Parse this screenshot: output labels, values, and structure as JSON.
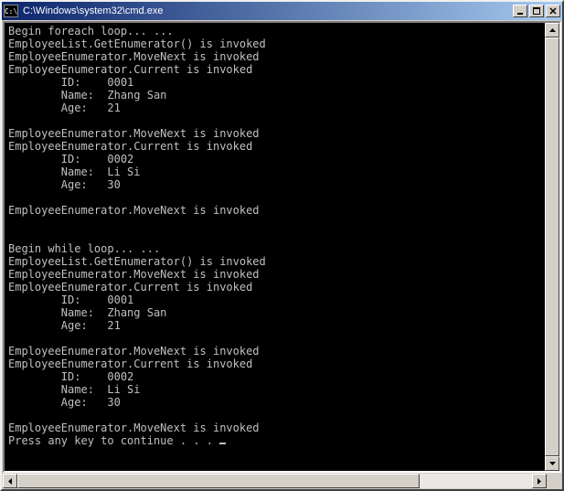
{
  "window": {
    "title": "C:\\Windows\\system32\\cmd.exe",
    "icon_label": "C:\\"
  },
  "console_output": {
    "lines": [
      "Begin foreach loop... ...",
      "EmployeeList.GetEnumerator() is invoked",
      "EmployeeEnumerator.MoveNext is invoked",
      "EmployeeEnumerator.Current is invoked",
      "        ID:    0001",
      "        Name:  Zhang San",
      "        Age:   21",
      "",
      "EmployeeEnumerator.MoveNext is invoked",
      "EmployeeEnumerator.Current is invoked",
      "        ID:    0002",
      "        Name:  Li Si",
      "        Age:   30",
      "",
      "EmployeeEnumerator.MoveNext is invoked",
      "",
      "",
      "Begin while loop... ...",
      "EmployeeList.GetEnumerator() is invoked",
      "EmployeeEnumerator.MoveNext is invoked",
      "EmployeeEnumerator.Current is invoked",
      "        ID:    0001",
      "        Name:  Zhang San",
      "        Age:   21",
      "",
      "EmployeeEnumerator.MoveNext is invoked",
      "EmployeeEnumerator.Current is invoked",
      "        ID:    0002",
      "        Name:  Li Si",
      "        Age:   30",
      "",
      "EmployeeEnumerator.MoveNext is invoked",
      "Press any key to continue . . . "
    ]
  }
}
